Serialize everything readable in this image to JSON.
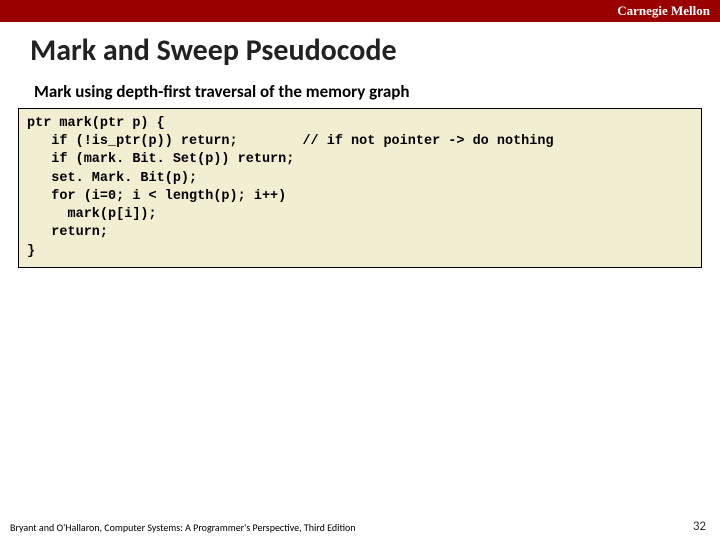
{
  "header": {
    "org": "Carnegie Mellon"
  },
  "title": "Mark and Sweep Pseudocode",
  "subtitle": "Mark using depth-first traversal of the memory graph",
  "code": "ptr mark(ptr p) {\n   if (!is_ptr(p)) return;        // if not pointer -> do nothing\n   if (mark. Bit. Set(p)) return;\n   set. Mark. Bit(p);\n   for (i=0; i < length(p); i++)\n     mark(p[i]);\n   return;\n}",
  "footer": {
    "left": "Bryant and O'Hallaron, Computer Systems: A Programmer's Perspective, Third Edition",
    "page": "32"
  }
}
